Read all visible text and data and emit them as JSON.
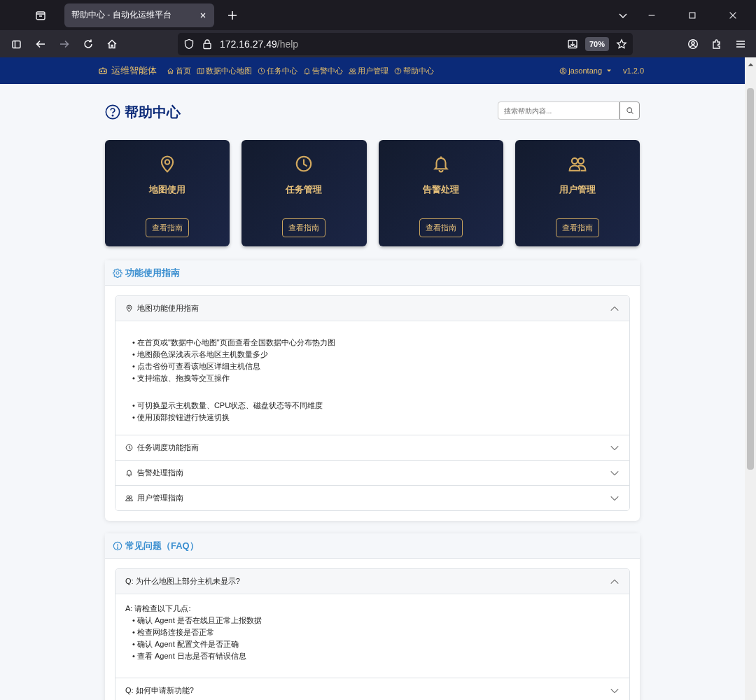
{
  "browser": {
    "tab_title": "帮助中心 - 自动化运维平台",
    "url_host": "172.16.27.49",
    "url_path": "/help",
    "zoom": "70%"
  },
  "nav": {
    "brand": "运维智能体",
    "items": [
      {
        "label": "首页"
      },
      {
        "label": "数据中心地图"
      },
      {
        "label": "任务中心"
      },
      {
        "label": "告警中心"
      },
      {
        "label": "用户管理"
      },
      {
        "label": "帮助中心"
      }
    ],
    "user": "jasontang",
    "version": "v1.2.0"
  },
  "page": {
    "title": "帮助中心",
    "search_placeholder": "搜索帮助内容..."
  },
  "cards": [
    {
      "title": "地图使用",
      "button": "查看指南"
    },
    {
      "title": "任务管理",
      "button": "查看指南"
    },
    {
      "title": "告警处理",
      "button": "查看指南"
    },
    {
      "title": "用户管理",
      "button": "查看指南"
    }
  ],
  "guide": {
    "title": "功能使用指南",
    "items": [
      {
        "title": "地图功能使用指南",
        "expanded": true,
        "lists": [
          [
            "• 在首页或\"数据中心地图\"页面查看全国数据中心分布热力图",
            "• 地图颜色深浅表示各地区主机数量多少",
            "• 点击省份可查看该地区详细主机信息",
            "• 支持缩放、拖拽等交互操作"
          ],
          [
            "• 可切换显示主机数量、CPU状态、磁盘状态等不同维度",
            "• 使用顶部按钮进行快速切换"
          ]
        ]
      },
      {
        "title": "任务调度功能指南",
        "expanded": false
      },
      {
        "title": "告警处理指南",
        "expanded": false
      },
      {
        "title": "用户管理指南",
        "expanded": false
      }
    ]
  },
  "faq": {
    "title": "常见问题（FAQ）",
    "items": [
      {
        "question": "Q: 为什么地图上部分主机未显示?",
        "expanded": true,
        "answer": "A: 请检查以下几点:",
        "bullets": [
          "• 确认 Agent 是否在线且正常上报数据",
          "• 检查网络连接是否正常",
          "• 确认 Agent 配置文件是否正确",
          "• 查看 Agent 日志是否有错误信息"
        ]
      },
      {
        "question": "Q: 如何申请新功能?",
        "expanded": false
      }
    ]
  }
}
